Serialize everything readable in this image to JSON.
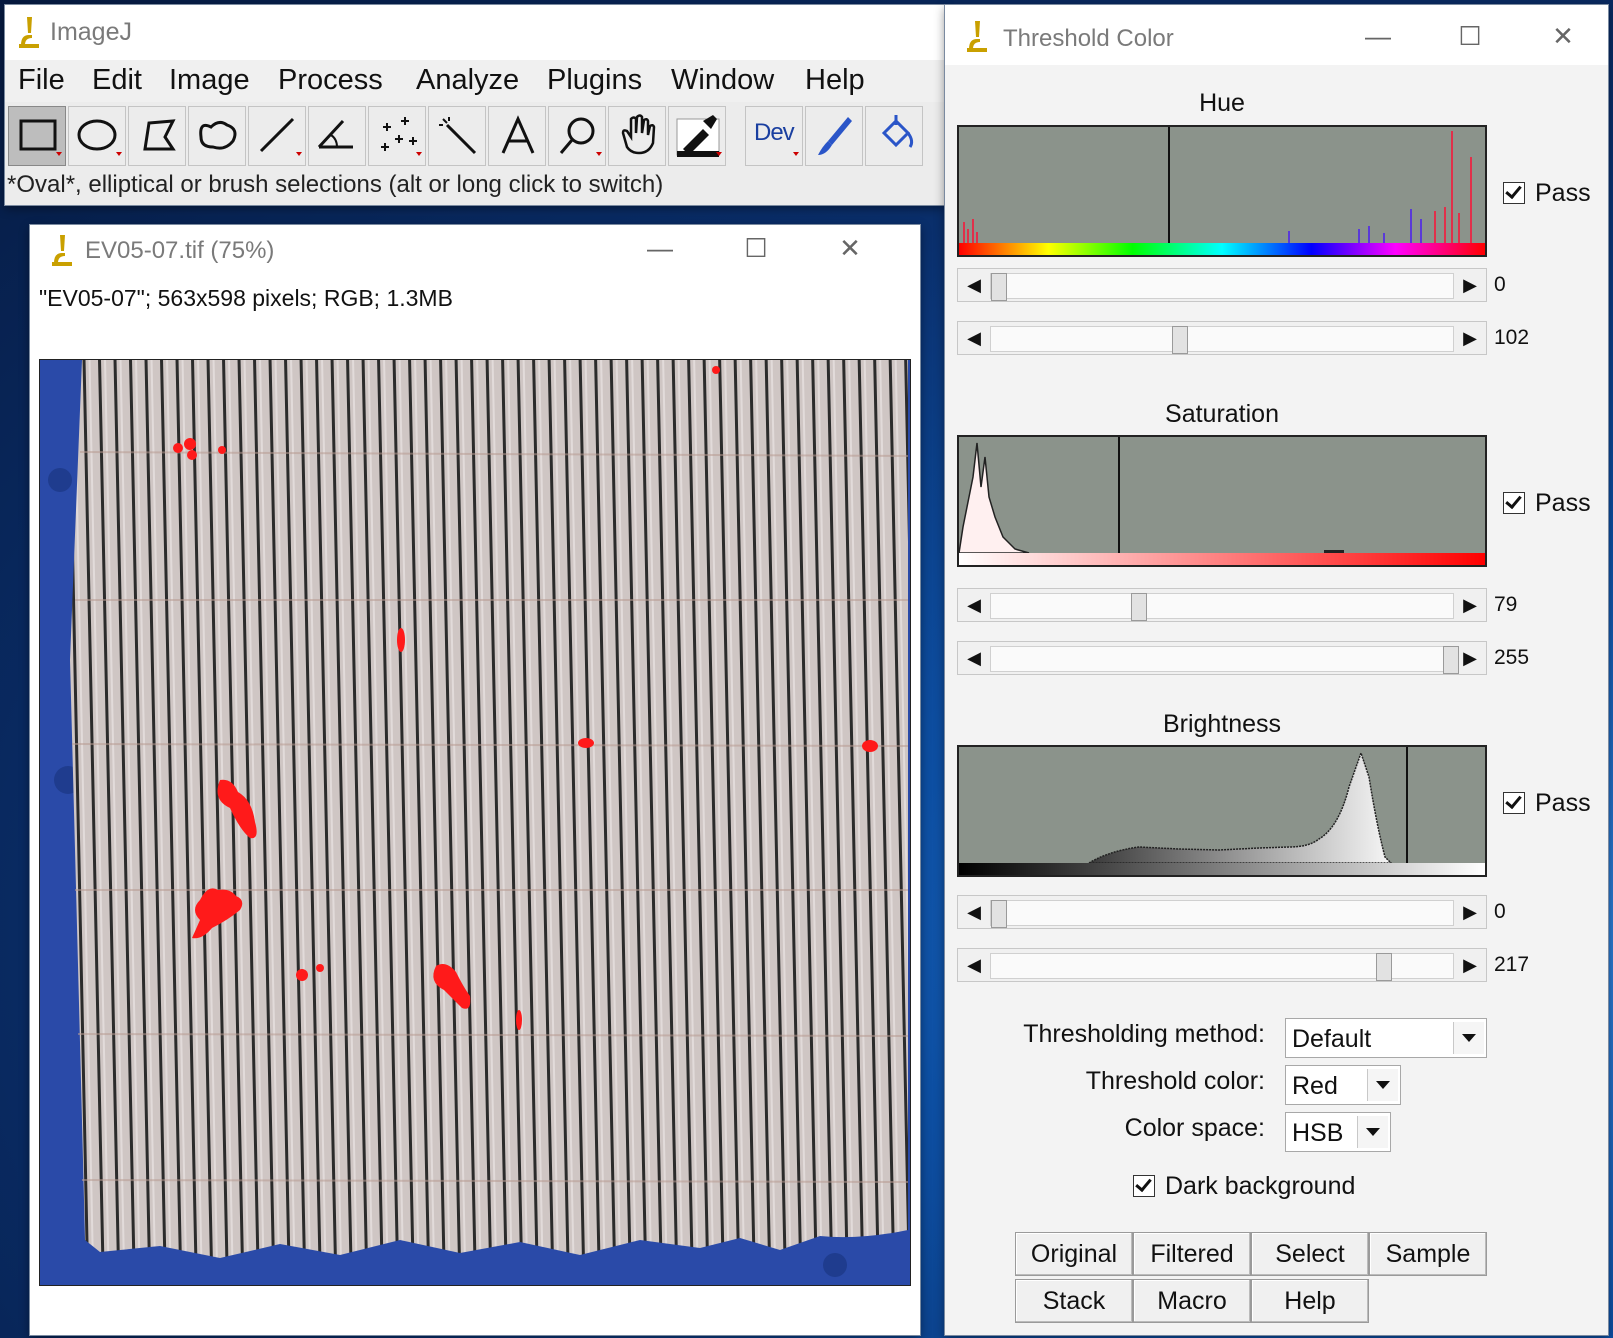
{
  "imagej": {
    "title": "ImageJ",
    "menu": [
      "File",
      "Edit",
      "Image",
      "Process",
      "Analyze",
      "Plugins",
      "Window",
      "Help"
    ],
    "tools": [
      "rectangle-tool",
      "oval-tool",
      "polygon-tool",
      "freehand-tool",
      "line-tool",
      "angle-tool",
      "point-tool",
      "wand-tool",
      "text-tool",
      "magnifier-tool",
      "hand-tool",
      "color-picker-tool",
      "dev-tool",
      "brush-tool",
      "flood-fill-tool"
    ],
    "dev_label": "Dev",
    "status": "*Oval*, elliptical or brush selections (alt or long click to switch)"
  },
  "image_window": {
    "title": "EV05-07.tif (75%)",
    "info": "\"EV05-07\"; 563x598 pixels; RGB; 1.3MB"
  },
  "threshold": {
    "title": "Threshold Color",
    "hue": {
      "label": "Hue",
      "pass": "Pass",
      "min": "0",
      "max": "102",
      "min_value": 0,
      "max_value": 102
    },
    "saturation": {
      "label": "Saturation",
      "pass": "Pass",
      "min": "79",
      "max": "255",
      "min_value": 79,
      "max_value": 255
    },
    "brightness": {
      "label": "Brightness",
      "pass": "Pass",
      "min": "0",
      "max": "217",
      "min_value": 0,
      "max_value": 217
    },
    "method_label": "Thresholding method:",
    "method_value": "Default",
    "color_label": "Threshold color:",
    "color_value": "Red",
    "space_label": "Color space:",
    "space_value": "HSB",
    "dark_background": "Dark background",
    "buttons": {
      "original": "Original",
      "filtered": "Filtered",
      "select": "Select",
      "sample": "Sample",
      "stack": "Stack",
      "macro": "Macro",
      "help": "Help"
    }
  },
  "window_controls": {
    "minimize": "—",
    "maximize": "☐",
    "close": "✕"
  },
  "colors": {
    "threshold_red": "#ff1a1a",
    "histogram_bg": "#8b938b",
    "fabric_bg": "#2a4aa8"
  }
}
